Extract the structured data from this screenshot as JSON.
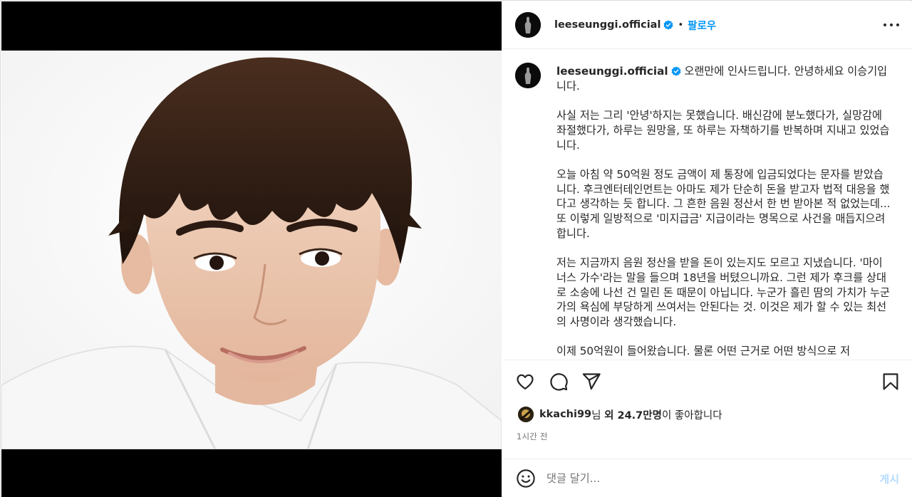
{
  "post": {
    "username": "leeseunggi.official",
    "verified_icon": "verified-badge-icon",
    "separator": "•",
    "follow_label": "팔로우",
    "more_icon": "more-options-icon"
  },
  "caption": {
    "author": "leeseunggi.official",
    "intro": "오랜만에 인사드립니다. 안녕하세요 이승기입니다.",
    "paragraphs": [
      "사실 저는 그리 '안녕'하지는 못했습니다. 배신감에 분노했다가, 실망감에 좌절했다가, 하루는 원망을, 또 하루는 자책하기를 반복하며 지내고 있었습니다.",
      "오늘 아침 약 50억원 정도 금액이 제 통장에 입금되었다는 문자를 받았습니다. 후크엔터테인먼트는 아마도 제가 단순히 돈을 받고자 법적 대응을 했다고 생각하는 듯 합니다. 그 흔한 음원 정산서 한 번 받아본 적 없었는데... 또 이렇게 일방적으로 '미지급금' 지급이라는 명목으로 사건을 매듭지으려 합니다.",
      "저는 지금까지 음원 정산을 받을 돈이 있는지도 모르고 지냈습니다. '마이너스 가수'라는 말을 들으며 18년을 버텼으니까요. 그런 제가 후크를 상대로 소송에 나선 건 밀린 돈 때문이 아닙니다. 누군가 흘린 땀의 가치가 누군가의 욕심에 부당하게 쓰여서는 안된다는 것. 이것은 제가 할 수 있는 최선의 사명이라 생각했습니다.",
      "이제 50억원이 들어왔습니다. 물론 어떤 근거로 어떤 방식으로 저"
    ]
  },
  "actions": {
    "like_icon": "heart-icon",
    "comment_icon": "comment-icon",
    "share_icon": "share-icon",
    "save_icon": "bookmark-icon"
  },
  "likes": {
    "user": "kkachi99",
    "suffix_nim": "님",
    "others": "외 24.7만명",
    "liked_text": "이 좋아합니다"
  },
  "timestamp": "1시간 전",
  "comment": {
    "emoji_icon": "emoji-icon",
    "placeholder": "댓글 달기...",
    "post_label": "게시"
  }
}
